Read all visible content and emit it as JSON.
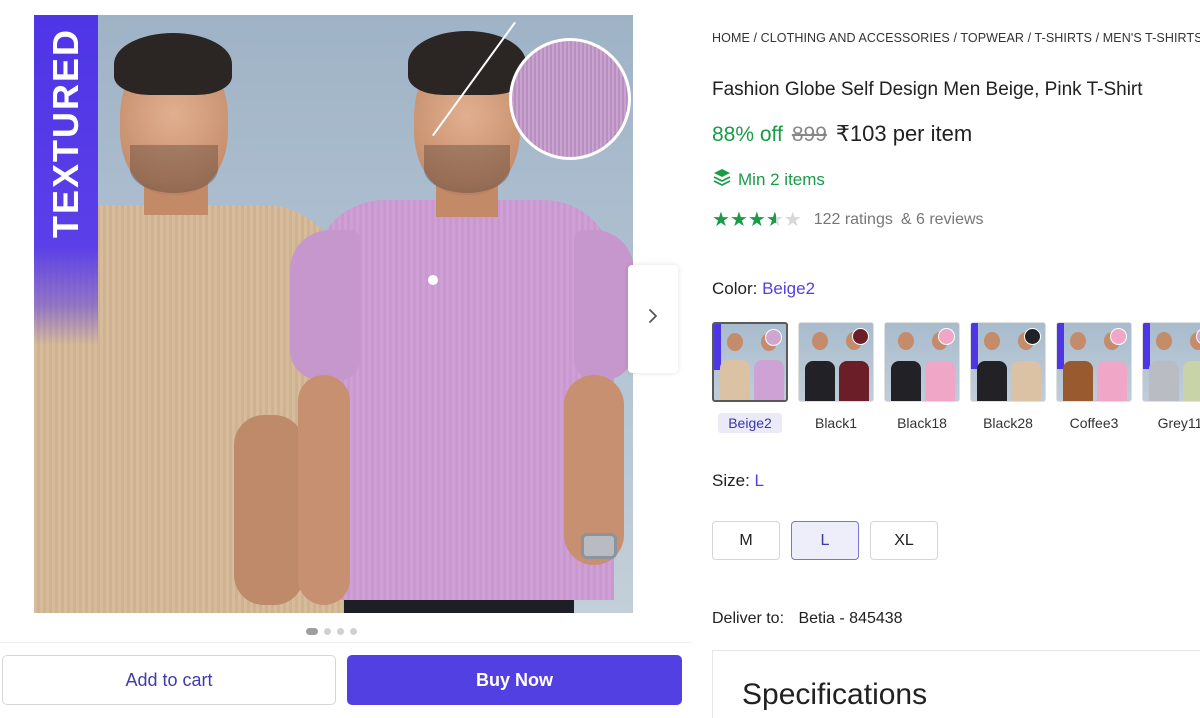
{
  "gallery": {
    "badge": "TEXTURED",
    "next_icon": "chevron-right-icon",
    "dots_count": 4,
    "active_dot": 1
  },
  "actions": {
    "add_to_cart": "Add to cart",
    "buy_now": "Buy Now"
  },
  "breadcrumb": "HOME / CLOTHING AND ACCESSORIES / TOPWEAR / T-SHIRTS / MEN'S T-SHIRTS /",
  "product": {
    "title": "Fashion Globe Self Design Men Beige, Pink T-Shirt",
    "discount": "88% off",
    "mrp": "899",
    "price": "₹103 per item",
    "min_items": "Min 2 items",
    "rating_value": 3.5,
    "ratings": "122 ratings",
    "reviews": "& 6 reviews"
  },
  "color": {
    "label": "Color:",
    "selected": "Beige2",
    "options": [
      {
        "name": "Beige2",
        "left": "#dcc2a4",
        "right": "#cfa2d6",
        "circle": "#cfa6cf",
        "textured": true
      },
      {
        "name": "Black1",
        "left": "#222226",
        "right": "#6b1d28",
        "circle": "#6b1d28",
        "textured": false
      },
      {
        "name": "Black18",
        "left": "#222226",
        "right": "#f0a6c6",
        "circle": "#f0a6c6",
        "textured": false
      },
      {
        "name": "Black28",
        "left": "#222226",
        "right": "#dcc2a4",
        "circle": "#222226",
        "textured": true
      },
      {
        "name": "Coffee3",
        "left": "#9a5a30",
        "right": "#f0a6c6",
        "circle": "#f0a6c6",
        "textured": true
      },
      {
        "name": "Grey11",
        "left": "#b9bdc3",
        "right": "#c9d3a8",
        "circle": "#cfa6cf",
        "textured": true
      }
    ]
  },
  "size": {
    "label": "Size:",
    "selected": "L",
    "options": [
      "M",
      "L",
      "XL"
    ]
  },
  "delivery": {
    "label": "Deliver to:",
    "value": "Betia - 845438"
  },
  "specifications": {
    "title": "Specifications"
  }
}
